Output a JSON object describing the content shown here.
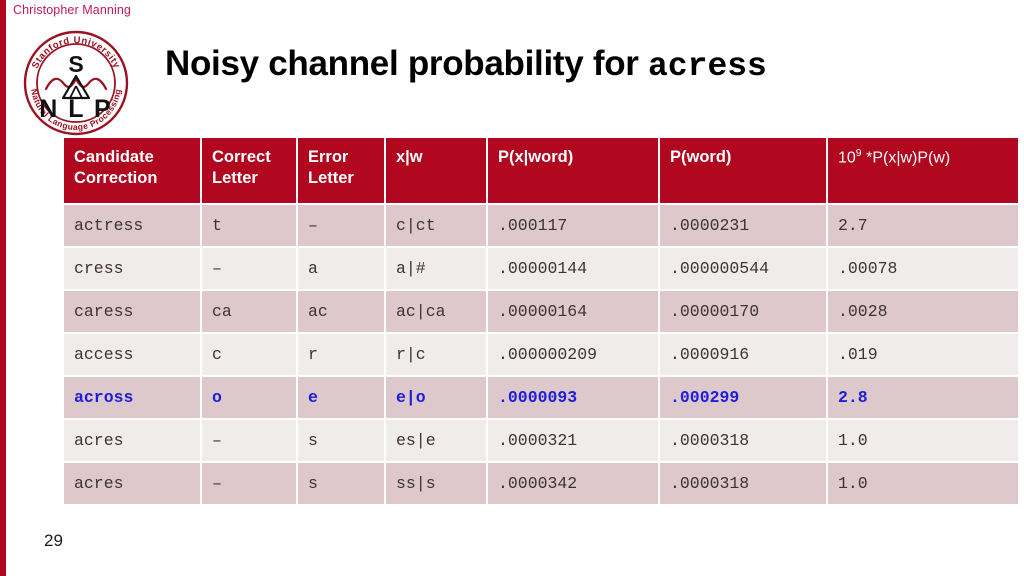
{
  "slide": {
    "author": "Christopher Manning",
    "title_main": "Noisy channel probability for ",
    "title_mono": "acress",
    "page_number": "29",
    "accent_color": "#b1071f",
    "author_color": "#c2185b",
    "highlight_color": "#1d1ddc"
  },
  "logo": {
    "top_arc_text": "Stanford University",
    "bottom_arc_text": "Natural Language Processing",
    "letter_top": "S",
    "letters_bottom": "N L P",
    "color": "#9c1220"
  },
  "table": {
    "headers": [
      "Candidate Correction",
      "Correct Letter",
      "Error Letter",
      "x|w",
      "P(x|word)",
      "P(word)",
      "10⁹ *P(x|w)P(w)"
    ],
    "header_parts": {
      "h0_line1": "Candidate",
      "h0_line2": "Correction",
      "h1_line1": "Correct",
      "h1_line2": "Letter",
      "h2_line1": "Error",
      "h2_line2": "Letter",
      "h3": "x|w",
      "h4": "P(x|word)",
      "h5": "P(word)",
      "h6_pre": "10",
      "h6_sup": "9",
      "h6_post": " *P(x|w)P(w)"
    },
    "rows": [
      {
        "candidate": "actress",
        "correct_letter": "t",
        "error_letter": "–",
        "xw": "c|ct",
        "p_x_word": ".000117",
        "p_word": ".0000231",
        "product": "2.7",
        "highlight": false
      },
      {
        "candidate": "cress",
        "correct_letter": "–",
        "error_letter": "a",
        "xw": "a|#",
        "p_x_word": ".00000144",
        "p_word": ".000000544",
        "product": ".00078",
        "highlight": false
      },
      {
        "candidate": "caress",
        "correct_letter": "ca",
        "error_letter": "ac",
        "xw": "ac|ca",
        "p_x_word": ".00000164",
        "p_word": ".00000170",
        "product": ".0028",
        "highlight": false
      },
      {
        "candidate": "access",
        "correct_letter": "c",
        "error_letter": "r",
        "xw": "r|c",
        "p_x_word": ".000000209",
        "p_word": ".0000916",
        "product": ".019",
        "highlight": false
      },
      {
        "candidate": "across",
        "correct_letter": "o",
        "error_letter": "e",
        "xw": "e|o",
        "p_x_word": ".0000093",
        "p_word": ".000299",
        "product": "2.8",
        "highlight": true
      },
      {
        "candidate": "acres",
        "correct_letter": "–",
        "error_letter": "s",
        "xw": "es|e",
        "p_x_word": ".0000321",
        "p_word": ".0000318",
        "product": "1.0",
        "highlight": false
      },
      {
        "candidate": "acres",
        "correct_letter": "–",
        "error_letter": "s",
        "xw": "ss|s",
        "p_x_word": ".0000342",
        "p_word": ".0000318",
        "product": "1.0",
        "highlight": false
      }
    ]
  }
}
